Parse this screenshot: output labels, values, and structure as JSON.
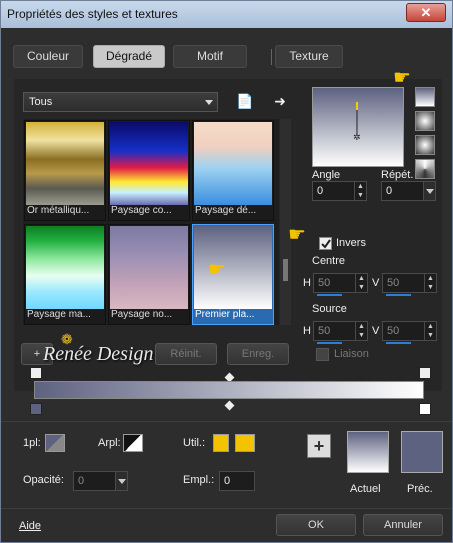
{
  "window": {
    "title": "Propriétés des styles et textures",
    "close": "✕"
  },
  "tabs": [
    {
      "label": "Couleur"
    },
    {
      "label": "Dégradé"
    },
    {
      "label": "Motif"
    },
    {
      "label": "Texture"
    }
  ],
  "active_tab": "Dégradé",
  "library": {
    "selected": "Tous"
  },
  "swatches": [
    {
      "label": "Or métalliqu...",
      "gradient": "linear-gradient(#d4b13a 0%,#f0e2a0 22%,#8a6e22 45%,#b89a4a 62%,#5a5a50 80%,#9b9b90 100%)"
    },
    {
      "label": "Paysage co...",
      "gradient": "linear-gradient(#0a0a6a 0%,#1530c8 35%,#e01a48 55%,#ffe830 72%,#c8f0ff 85%,#6b6bb0 100%)"
    },
    {
      "label": "Paysage dé...",
      "gradient": "linear-gradient(#f5dcc8 0%,#f0d0c0 30%,#9fd2f0 55%,#3a8ee0 100%)"
    },
    {
      "label": "Paysage ma...",
      "gradient": "linear-gradient(#0f7d22 0%,#22b040 18%,#8fe8a0 40%,#e8fff0 60%,#98e8ff 80%,#70d8ff 100%)"
    },
    {
      "label": "Paysage no...",
      "gradient": "linear-gradient(#7c79a0 0%,#9b8fb4 35%,#c2a2b8 70%,#d8b8c0 100%)"
    },
    {
      "label": "Premier pla...",
      "gradient": "linear-gradient(#5d6280 0%,#ffffff 100%)"
    }
  ],
  "properties": {
    "angle_label": "Angle",
    "angle": "0",
    "repeat_label": "Répét.",
    "repeat": "0",
    "invert_label": "Invers",
    "center_label": "Centre",
    "center_h": "50",
    "center_v": "50",
    "source_label": "Source",
    "source_h": "50",
    "source_v": "50",
    "h": "H",
    "v": "V",
    "link_label": "Liaison"
  },
  "buttons": {
    "add": "+",
    "reset": "Réinit.",
    "save": "Enreg.",
    "ok": "OK",
    "cancel": "Annuler",
    "help": "Aide"
  },
  "watermark": "Renée Design",
  "bottom": {
    "opacity_label": "1pl:",
    "arpl_label": "Arpl:",
    "util_label": "Util.:",
    "opacite_label": "Opacité:",
    "opacite_value": "0",
    "empl_label": "Empl.:",
    "empl_value": "0",
    "current_label": "Actuel",
    "prev_label": "Préc."
  },
  "colors": {
    "foreground": "#5d6280",
    "background": "#ffffff",
    "util1": "#f3c200",
    "util2": "#f3c200",
    "prev_swatch": "#5d6280"
  }
}
